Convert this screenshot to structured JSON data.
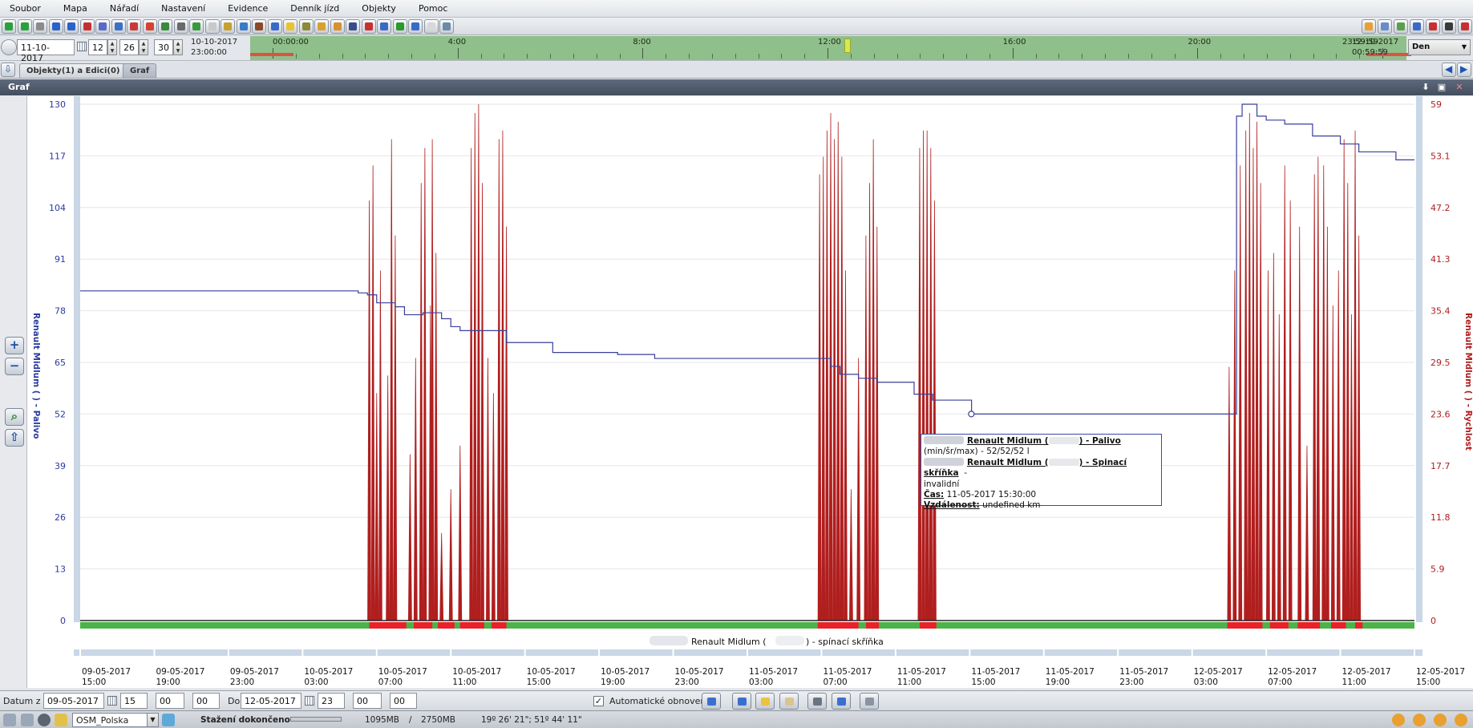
{
  "menu": [
    "Soubor",
    "Mapa",
    "Nářadí",
    "Nastavení",
    "Evidence",
    "Denník jízd",
    "Objekty",
    "Pomoc"
  ],
  "timebar": {
    "date": "11-10-2017",
    "hour": "12",
    "minute": "26",
    "second": "30",
    "left_date": "10-10-2017",
    "left_time": "23:00:00",
    "right_date": "12-10-2017",
    "right_time": "00:59:59",
    "labels": [
      "00:00:00",
      "4:00",
      "8:00",
      "12:00",
      "16:00",
      "20:00",
      "23:59:59"
    ],
    "period": "Den"
  },
  "tabs": [
    "Objekty(1) a Edici(0)",
    "Graf"
  ],
  "panel": {
    "title": "Graf"
  },
  "tooltip": {
    "line1_name": "Renault Midlum (",
    "line1_rest": ") - Palivo",
    "line2": "(min/šr/max) - 52/52/52 l",
    "line3_name": "Renault Midlum (",
    "line3_rest": ") - Spinací skříňka",
    "line3_dash": "-",
    "line4": "invalidní",
    "time_label": "Čas:",
    "time_value": "11-05-2017 15:30:00",
    "dist_label": "Vzdálenost:",
    "dist_value": "undefined km"
  },
  "chart_data": {
    "type": "line",
    "left_axis": {
      "label": "Renault Midlum (       ) - Palivo",
      "ticks": [
        0,
        13,
        26,
        39,
        52,
        65,
        78,
        91,
        104,
        117,
        130
      ],
      "range": [
        0,
        130
      ]
    },
    "right_axis": {
      "label": "Renault Midlum (       ) - Rychlost",
      "ticks": [
        "0",
        "5.9",
        "11.8",
        "17.7",
        "23.6",
        "29.5",
        "35.4",
        "41.3",
        "47.2",
        "53.1",
        "59"
      ],
      "range": [
        0,
        59
      ]
    },
    "x_labels": [
      [
        "09-05-2017",
        "15:00"
      ],
      [
        "09-05-2017",
        "19:00"
      ],
      [
        "09-05-2017",
        "23:00"
      ],
      [
        "10-05-2017",
        "03:00"
      ],
      [
        "10-05-2017",
        "07:00"
      ],
      [
        "10-05-2017",
        "11:00"
      ],
      [
        "10-05-2017",
        "15:00"
      ],
      [
        "10-05-2017",
        "19:00"
      ],
      [
        "10-05-2017",
        "23:00"
      ],
      [
        "11-05-2017",
        "03:00"
      ],
      [
        "11-05-2017",
        "07:00"
      ],
      [
        "11-05-2017",
        "11:00"
      ],
      [
        "11-05-2017",
        "15:00"
      ],
      [
        "11-05-2017",
        "19:00"
      ],
      [
        "11-05-2017",
        "23:00"
      ],
      [
        "12-05-2017",
        "03:00"
      ],
      [
        "12-05-2017",
        "07:00"
      ],
      [
        "12-05-2017",
        "11:00"
      ],
      [
        "12-05-2017",
        "15:00"
      ],
      [
        "12-05-2017",
        "19:00"
      ],
      [
        "12-05-2017",
        "23:00"
      ]
    ],
    "x_range_hours": [
      15,
      87
    ],
    "ignition_label_name": "Renault Midlum (",
    "ignition_label_rest": ") - spínací skříňka",
    "series": [
      {
        "name": "Palivo",
        "axis": "left",
        "color": "#3a3f9a",
        "points": [
          [
            15,
            83
          ],
          [
            29,
            83
          ],
          [
            30,
            82.5
          ],
          [
            30.5,
            82
          ],
          [
            31,
            80
          ],
          [
            32,
            79
          ],
          [
            32.5,
            77
          ],
          [
            33.5,
            77.5
          ],
          [
            34.5,
            76
          ],
          [
            35,
            74
          ],
          [
            35.5,
            73
          ],
          [
            37,
            73
          ],
          [
            38,
            70
          ],
          [
            40,
            70
          ],
          [
            40.5,
            67.5
          ],
          [
            44,
            67
          ],
          [
            46,
            66
          ],
          [
            55,
            66
          ],
          [
            55.2,
            66
          ],
          [
            55.5,
            64
          ],
          [
            56,
            62
          ],
          [
            57,
            61
          ],
          [
            58,
            60
          ],
          [
            60,
            57
          ],
          [
            61,
            55.5
          ],
          [
            63,
            55.5
          ],
          [
            63.1,
            52
          ],
          [
            77.2,
            52
          ],
          [
            77.4,
            127
          ],
          [
            77.7,
            130
          ],
          [
            78.5,
            127
          ],
          [
            79,
            126
          ],
          [
            80,
            125
          ],
          [
            81.5,
            122
          ],
          [
            83,
            120
          ],
          [
            84,
            118
          ],
          [
            85,
            118
          ],
          [
            86,
            116
          ],
          [
            87,
            116
          ]
        ]
      },
      {
        "name": "Rychlost",
        "axis": "right",
        "color": "#b01e1e",
        "spikes": [
          [
            30.6,
            48
          ],
          [
            30.8,
            52
          ],
          [
            31.0,
            26
          ],
          [
            31.2,
            40
          ],
          [
            31.6,
            28
          ],
          [
            31.8,
            55
          ],
          [
            32.0,
            44
          ],
          [
            32.8,
            19
          ],
          [
            33.1,
            30
          ],
          [
            33.4,
            50
          ],
          [
            33.6,
            54
          ],
          [
            33.9,
            36
          ],
          [
            34.0,
            55
          ],
          [
            34.2,
            42
          ],
          [
            34.5,
            10
          ],
          [
            35.0,
            15
          ],
          [
            35.5,
            20
          ],
          [
            36.1,
            54
          ],
          [
            36.3,
            58
          ],
          [
            36.5,
            59
          ],
          [
            36.7,
            50
          ],
          [
            37.0,
            30
          ],
          [
            37.3,
            26
          ],
          [
            37.6,
            55
          ],
          [
            37.8,
            56
          ],
          [
            38.0,
            45
          ],
          [
            54.9,
            51
          ],
          [
            55.1,
            53
          ],
          [
            55.3,
            56
          ],
          [
            55.5,
            58
          ],
          [
            55.7,
            55
          ],
          [
            55.9,
            57
          ],
          [
            56.1,
            53
          ],
          [
            56.3,
            40
          ],
          [
            56.6,
            15
          ],
          [
            57.0,
            30
          ],
          [
            57.4,
            44
          ],
          [
            57.6,
            50
          ],
          [
            57.8,
            55
          ],
          [
            58.0,
            45
          ],
          [
            60.3,
            54
          ],
          [
            60.5,
            56
          ],
          [
            60.7,
            56
          ],
          [
            60.9,
            54
          ],
          [
            61.1,
            48
          ],
          [
            77.0,
            29
          ],
          [
            77.3,
            40
          ],
          [
            77.6,
            52
          ],
          [
            77.9,
            56
          ],
          [
            78.1,
            58
          ],
          [
            78.3,
            54
          ],
          [
            78.5,
            57
          ],
          [
            78.7,
            50
          ],
          [
            79.1,
            40
          ],
          [
            79.4,
            42
          ],
          [
            79.7,
            35
          ],
          [
            80.0,
            52
          ],
          [
            80.3,
            48
          ],
          [
            80.8,
            45
          ],
          [
            81.2,
            20
          ],
          [
            81.6,
            51
          ],
          [
            81.8,
            53
          ],
          [
            82.1,
            52
          ],
          [
            82.3,
            45
          ],
          [
            82.6,
            36
          ],
          [
            82.9,
            40
          ],
          [
            83.2,
            55
          ],
          [
            83.4,
            50
          ],
          [
            83.6,
            35
          ],
          [
            83.8,
            56
          ],
          [
            84.0,
            44
          ]
        ]
      }
    ],
    "ignition": {
      "on_color": "#e8212b",
      "off_color": "#4cb34a",
      "on_ranges": [
        [
          30.6,
          32.6
        ],
        [
          33.0,
          34.0
        ],
        [
          34.3,
          35.2
        ],
        [
          35.5,
          36.8
        ],
        [
          37.2,
          38.0
        ],
        [
          54.8,
          57.0
        ],
        [
          57.4,
          58.1
        ],
        [
          60.3,
          61.2
        ],
        [
          76.9,
          78.8
        ],
        [
          79.2,
          80.2
        ],
        [
          80.7,
          81.9
        ],
        [
          82.5,
          83.3
        ],
        [
          83.8,
          84.2
        ]
      ]
    }
  },
  "bottom": {
    "from_label": "Datum z",
    "from_date": "09-05-2017",
    "from_h": "15",
    "from_m": "00",
    "from_s": "00",
    "to_label": "Do",
    "to_date": "12-05-2017",
    "to_h": "23",
    "to_m": "00",
    "to_s": "00",
    "auto_refresh": "Automatické obnovení"
  },
  "status": {
    "map": "OSM_Polska",
    "download": "Stažení dokončeno",
    "mem1": "1095MB",
    "slash": "/",
    "mem2": "2750MB",
    "coords": "19º 26' 21\";  51º 44' 11\""
  }
}
